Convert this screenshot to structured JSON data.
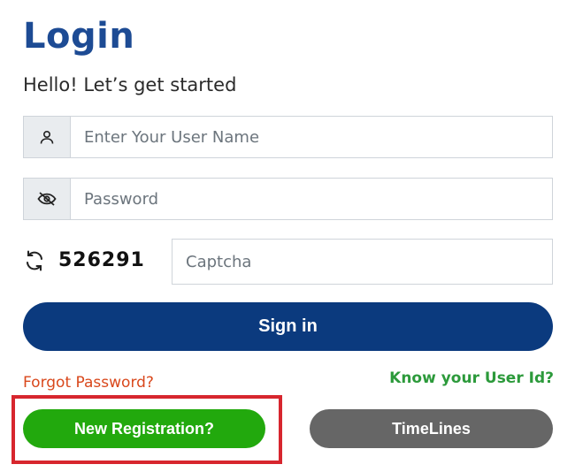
{
  "header": {
    "title": "Login",
    "subtitle": "Hello! Let’s get started"
  },
  "form": {
    "username": {
      "placeholder": "Enter Your User Name",
      "value": "",
      "icon": "user-icon"
    },
    "password": {
      "placeholder": "Password",
      "value": "",
      "icon": "eye-off-icon"
    },
    "captcha": {
      "code": "526291",
      "placeholder": "Captcha",
      "value": "",
      "icon": "refresh-icon"
    },
    "signin_label": "Sign in"
  },
  "links": {
    "forgot_password": "Forgot Password?",
    "know_user_id": "Know your User Id?"
  },
  "actions": {
    "new_registration": "New Registration?",
    "timelines": "TimeLines"
  },
  "colors": {
    "title": "#1d4b94",
    "signin": "#0b3a7e",
    "forgot": "#d9481c",
    "know_user_id": "#2c9a3b",
    "new_registration": "#22a90d",
    "timelines": "#666666",
    "highlight": "#d7262e"
  }
}
